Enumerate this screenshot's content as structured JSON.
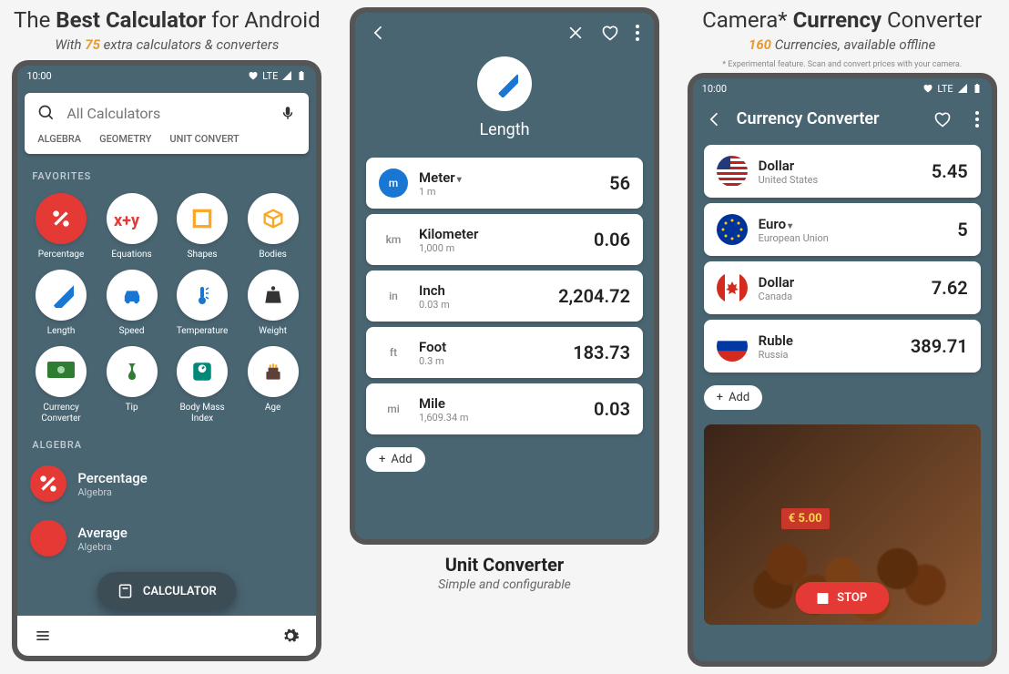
{
  "panel1": {
    "headline_pre": "The ",
    "headline_bold": "Best Calculator",
    "headline_post": " for Android",
    "subline_pre": "With ",
    "subline_accent": "75",
    "subline_post": " extra calculators & converters",
    "status_time": "10:00",
    "status_lte": "LTE",
    "search_placeholder": "All Calculators",
    "tabs": [
      "ALGEBRA",
      "GEOMETRY",
      "UNIT CONVERT"
    ],
    "favorites_label": "FAVORITES",
    "grid": [
      {
        "label": "Percentage",
        "icon": "percent",
        "red": true
      },
      {
        "label": "Equations",
        "icon": "xy"
      },
      {
        "label": "Shapes",
        "icon": "square"
      },
      {
        "label": "Bodies",
        "icon": "cube"
      },
      {
        "label": "Length",
        "icon": "ruler"
      },
      {
        "label": "Speed",
        "icon": "car"
      },
      {
        "label": "Temperature",
        "icon": "therm"
      },
      {
        "label": "Weight",
        "icon": "weight"
      },
      {
        "label": "Currency Converter",
        "icon": "money"
      },
      {
        "label": "Tip",
        "icon": "tip"
      },
      {
        "label": "Body Mass Index",
        "icon": "scale"
      },
      {
        "label": "Age",
        "icon": "cake"
      }
    ],
    "algebra_label": "ALGEBRA",
    "list": [
      {
        "title": "Percentage",
        "sub": "Algebra",
        "icon": "percent"
      },
      {
        "title": "Average",
        "sub": "Algebra",
        "icon": "avg"
      }
    ],
    "fab_label": "CALCULATOR"
  },
  "panel2": {
    "title": "Length",
    "units": [
      {
        "badge": "m",
        "blue": true,
        "name": "Meter",
        "caret": true,
        "sub": "1 m",
        "val": "56"
      },
      {
        "badge": "km",
        "name": "Kilometer",
        "sub": "1,000 m",
        "val": "0.06"
      },
      {
        "badge": "in",
        "name": "Inch",
        "sub": "0.03 m",
        "val": "2,204.72"
      },
      {
        "badge": "ft",
        "name": "Foot",
        "sub": "0.3 m",
        "val": "183.73"
      },
      {
        "badge": "mi",
        "name": "Mile",
        "sub": "1,609.34 m",
        "val": "0.03"
      }
    ],
    "add_label": "Add",
    "footer_title": "Unit Converter",
    "footer_sub": "Simple and configurable"
  },
  "panel3": {
    "headline_pre": "Camera* ",
    "headline_bold": "Currency",
    "headline_post": " Converter",
    "subline_accent": "160",
    "subline_post": " Currencies, available offline",
    "microtext": "* Experimental feature. Scan and convert prices with your camera.",
    "status_time": "10:00",
    "status_lte": "LTE",
    "appbar_title": "Currency Converter",
    "currencies": [
      {
        "flag": "us",
        "name": "Dollar",
        "sub": "United States",
        "val": "5.45"
      },
      {
        "flag": "eu",
        "name": "Euro",
        "caret": true,
        "sub": "European Union",
        "val": "5"
      },
      {
        "flag": "ca",
        "name": "Dollar",
        "sub": "Canada",
        "val": "7.62"
      },
      {
        "flag": "ru",
        "name": "Ruble",
        "sub": "Russia",
        "val": "389.71"
      }
    ],
    "add_label": "Add",
    "price_tag": "€ 5.00",
    "stop_label": "STOP"
  }
}
